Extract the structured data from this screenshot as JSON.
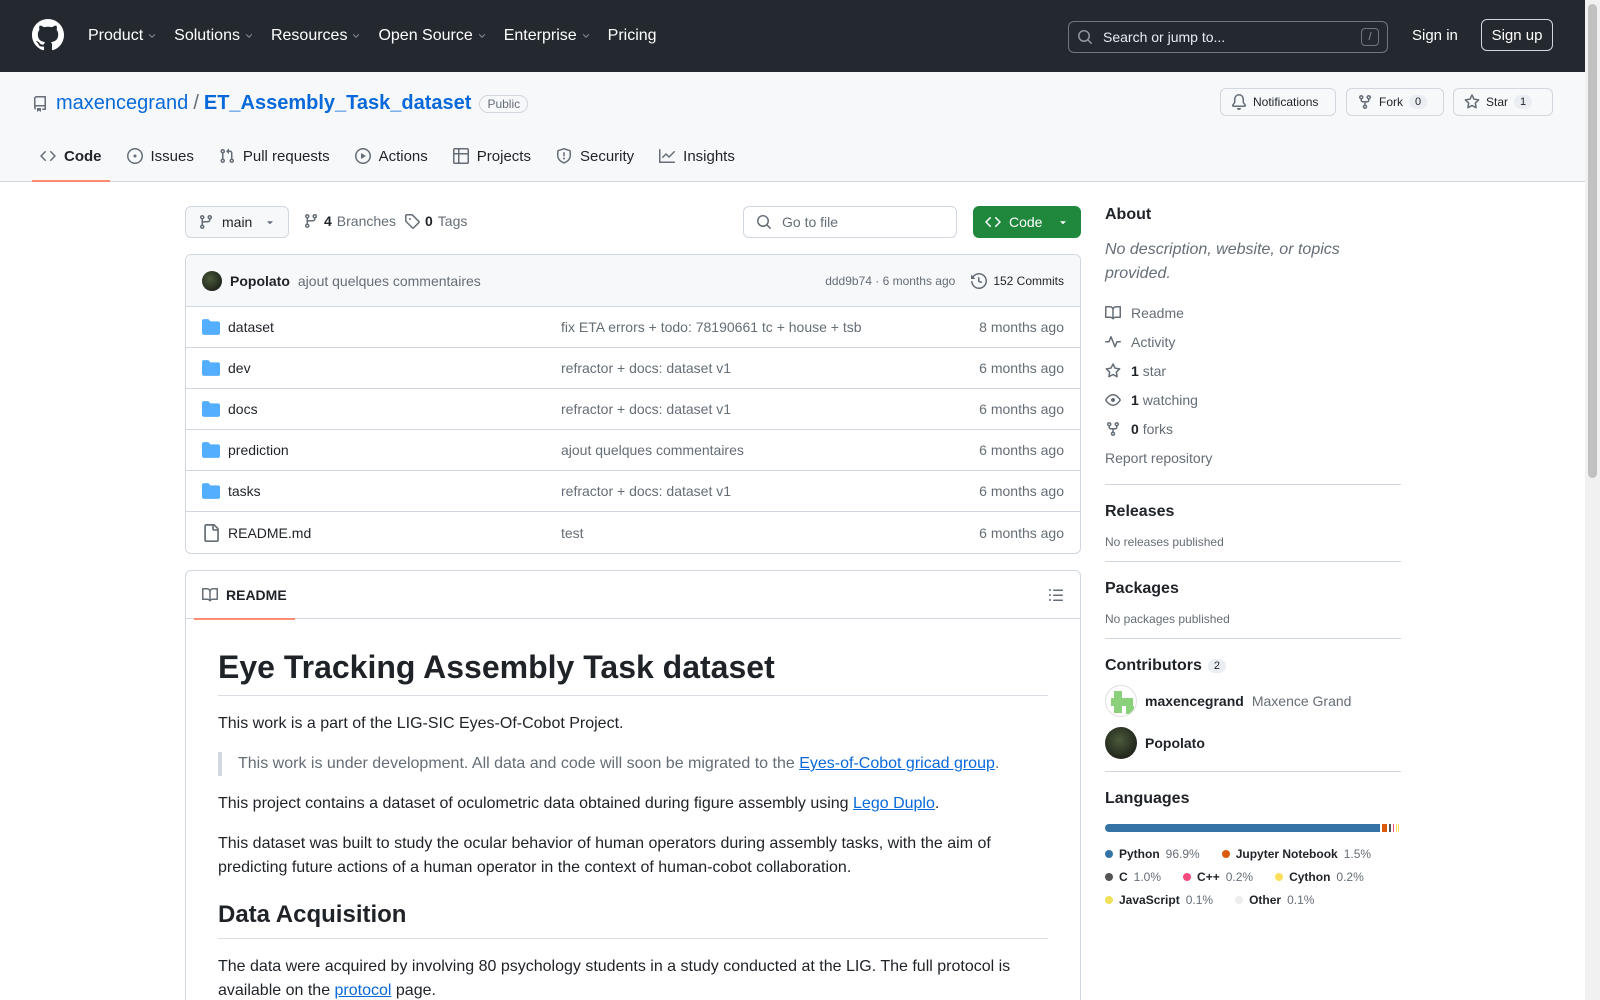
{
  "topnav": {
    "items": [
      {
        "label": "Product",
        "has_chevron": true
      },
      {
        "label": "Solutions",
        "has_chevron": true
      },
      {
        "label": "Resources",
        "has_chevron": true
      },
      {
        "label": "Open Source",
        "has_chevron": true
      },
      {
        "label": "Enterprise",
        "has_chevron": true
      },
      {
        "label": "Pricing",
        "has_chevron": false
      }
    ],
    "search_placeholder": "Search or jump to...",
    "search_shortcut": "/",
    "signin": "Sign in",
    "signup": "Sign up"
  },
  "repo": {
    "owner": "maxencegrand",
    "separator": "/",
    "name": "ET_Assembly_Task_dataset",
    "visibility": "Public",
    "notifications_label": "Notifications",
    "fork_label": "Fork",
    "fork_count": "0",
    "star_label": "Star",
    "star_count": "1"
  },
  "tabs": [
    {
      "label": "Code",
      "icon": "code-icon",
      "active": true
    },
    {
      "label": "Issues",
      "icon": "issue-icon"
    },
    {
      "label": "Pull requests",
      "icon": "pull-request-icon"
    },
    {
      "label": "Actions",
      "icon": "play-icon"
    },
    {
      "label": "Projects",
      "icon": "table-icon"
    },
    {
      "label": "Security",
      "icon": "shield-icon"
    },
    {
      "label": "Insights",
      "icon": "graph-icon"
    }
  ],
  "branch": {
    "current": "main",
    "branches_count": "4",
    "branches_label": "Branches",
    "tags_count": "0",
    "tags_label": "Tags",
    "goto_placeholder": "Go to file",
    "code_button": "Code"
  },
  "latest_commit": {
    "author": "Popolato",
    "message": "ajout quelques commentaires",
    "hash_time": "ddd9b74 · 6 months ago",
    "commits_label": "152 Commits"
  },
  "files": [
    {
      "name": "dataset",
      "type": "folder",
      "message": "fix ETA errors + todo: 78190661 tc + house + tsb",
      "date": "8 months ago"
    },
    {
      "name": "dev",
      "type": "folder",
      "message": "refractor + docs: dataset v1",
      "date": "6 months ago"
    },
    {
      "name": "docs",
      "type": "folder",
      "message": "refractor + docs: dataset v1",
      "date": "6 months ago"
    },
    {
      "name": "prediction",
      "type": "folder",
      "message": "ajout quelques commentaires",
      "date": "6 months ago"
    },
    {
      "name": "tasks",
      "type": "folder",
      "message": "refractor + docs: dataset v1",
      "date": "6 months ago"
    },
    {
      "name": "README.md",
      "type": "file",
      "message": "test",
      "date": "6 months ago"
    }
  ],
  "readme": {
    "tab_label": "README",
    "h1": "Eye Tracking Assembly Task dataset",
    "p1": "This work is a part of the LIG-SIC Eyes-Of-Cobot Project.",
    "quote_text": "This work is under development. All data and code will soon be migrated to the ",
    "quote_link": "Eyes-of-Cobot gricad group",
    "quote_end": ".",
    "p2_text": "This project contains a dataset of oculometric data obtained during figure assembly using ",
    "p2_link": "Lego Duplo",
    "p2_end": ".",
    "p3": "This dataset was built to study the ocular behavior of human operators during assembly tasks, with the aim of predicting future actions of a human operator in the context of human-cobot collaboration.",
    "h2": "Data Acquisition",
    "p4_text": "The data were acquired by involving 80 psychology students in a study conducted at the LIG. The full protocol is available on the ",
    "p4_link": "protocol",
    "p4_end": " page."
  },
  "about": {
    "title": "About",
    "description": "No description, website, or topics provided.",
    "items": [
      {
        "icon": "book-icon",
        "bold": "",
        "label": "Readme"
      },
      {
        "icon": "pulse-icon",
        "bold": "",
        "label": "Activity"
      },
      {
        "icon": "star-icon",
        "bold": "1",
        "label": "star"
      },
      {
        "icon": "eye-icon",
        "bold": "1",
        "label": "watching"
      },
      {
        "icon": "fork-icon",
        "bold": "0",
        "label": "forks"
      }
    ],
    "report": "Report repository"
  },
  "releases": {
    "title": "Releases",
    "text": "No releases published"
  },
  "packages": {
    "title": "Packages",
    "text": "No packages published"
  },
  "contributors": {
    "title": "Contributors",
    "count": "2",
    "list": [
      {
        "login": "maxencegrand",
        "name": "Maxence Grand"
      },
      {
        "login": "Popolato",
        "name": ""
      }
    ]
  },
  "languages": {
    "title": "Languages",
    "list": [
      {
        "name": "Python",
        "pct": "96.9%",
        "value": 96.9,
        "color": "#3572A5"
      },
      {
        "name": "Jupyter Notebook",
        "pct": "1.5%",
        "value": 1.5,
        "color": "#DA5B0B"
      },
      {
        "name": "C",
        "pct": "1.0%",
        "value": 1.0,
        "color": "#555555"
      },
      {
        "name": "C++",
        "pct": "0.2%",
        "value": 0.2,
        "color": "#f34b7d"
      },
      {
        "name": "Cython",
        "pct": "0.2%",
        "value": 0.2,
        "color": "#fedf5b"
      },
      {
        "name": "JavaScript",
        "pct": "0.1%",
        "value": 0.1,
        "color": "#f1e05a"
      },
      {
        "name": "Other",
        "pct": "0.1%",
        "value": 0.1,
        "color": "#ededed"
      }
    ]
  }
}
